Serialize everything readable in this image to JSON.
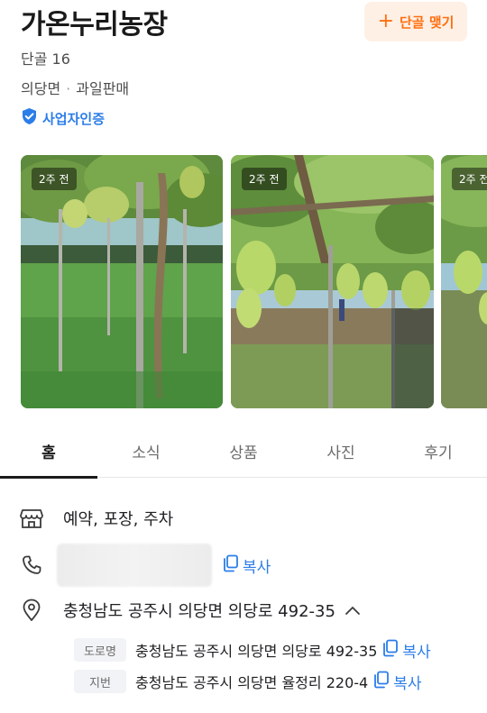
{
  "store": {
    "name": "가온누리농장",
    "follow_label": "단골 맺기",
    "regulars": "단골 16",
    "area": "의당면",
    "category": "과일판매",
    "certification": "사업자인증"
  },
  "gallery": {
    "badges": [
      "2주 전",
      "2주 전",
      "2주 전"
    ]
  },
  "tabs": [
    "홈",
    "소식",
    "상품",
    "사진",
    "후기"
  ],
  "info": {
    "amenities": "예약, 포장, 주차",
    "copy_label": "복사",
    "address": "충청남도 공주시 의당면 의당로 492-35",
    "road_tag": "도로명",
    "road_address": "충청남도 공주시 의당면 의당로 492-35",
    "lot_tag": "지번",
    "lot_address": "충청남도 공주시 의당면 율정리 220-4"
  },
  "colors": {
    "brand_orange": "#ff6f0f",
    "link_blue": "#2b7de9"
  }
}
